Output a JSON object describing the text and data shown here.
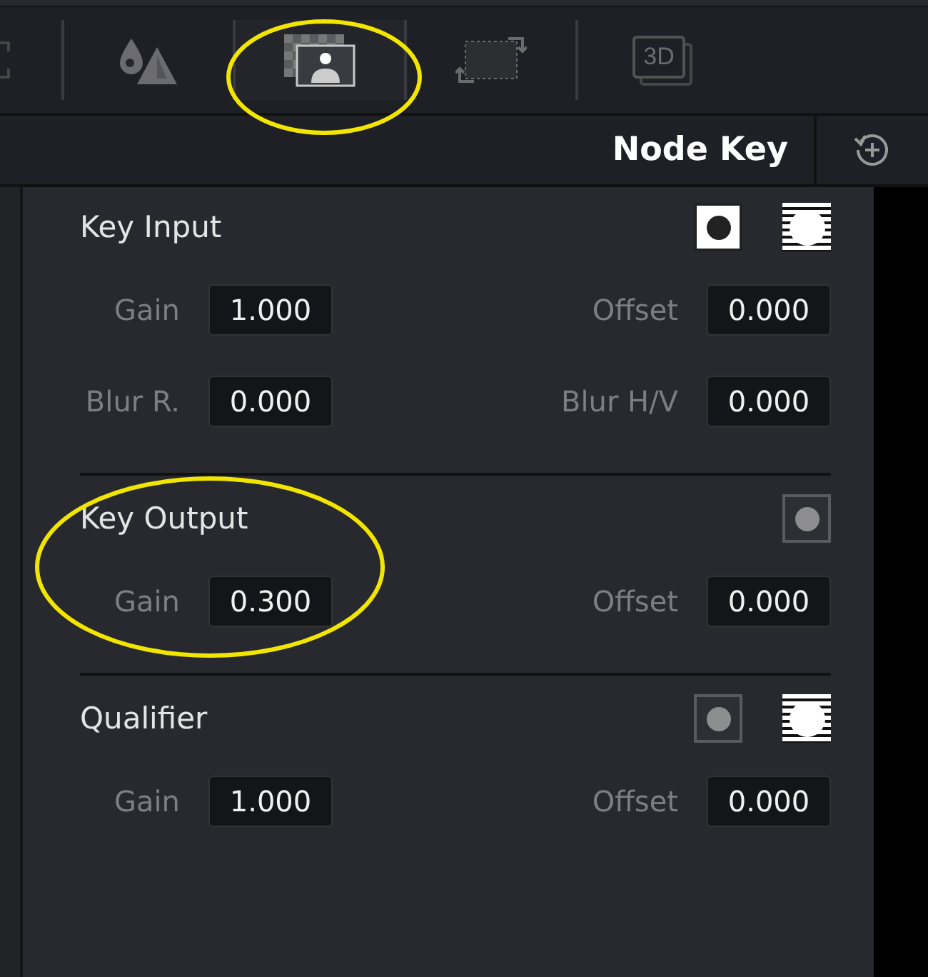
{
  "toolbar": {
    "tools": [
      {
        "kind": "partial",
        "selected": false
      },
      {
        "kind": "qualifier",
        "selected": false
      },
      {
        "kind": "key",
        "selected": true
      },
      {
        "kind": "sizing",
        "selected": false
      },
      {
        "kind": "stereo",
        "label": "3D",
        "selected": false
      }
    ]
  },
  "header": {
    "title": "Node Key"
  },
  "sections": [
    {
      "title": "Key Input",
      "toggles": [
        {
          "kind": "dot",
          "on": true
        },
        {
          "kind": "matte"
        }
      ],
      "rows": [
        [
          {
            "label": "Gain",
            "value": "1.000"
          },
          {
            "label": "Offset",
            "value": "0.000"
          }
        ],
        [
          {
            "label": "Blur R.",
            "value": "0.000"
          },
          {
            "label": "Blur H/V",
            "value": "0.000"
          }
        ]
      ]
    },
    {
      "title": "Key Output",
      "toggles": [
        {
          "kind": "dot",
          "on": false
        }
      ],
      "rows": [
        [
          {
            "label": "Gain",
            "value": "0.300"
          },
          {
            "label": "Offset",
            "value": "0.000"
          }
        ]
      ]
    },
    {
      "title": "Qualifier",
      "toggles": [
        {
          "kind": "dot",
          "on": false
        },
        {
          "kind": "matte"
        }
      ],
      "rows": [
        [
          {
            "label": "Gain",
            "value": "1.000"
          },
          {
            "label": "Offset",
            "value": "0.000"
          }
        ]
      ]
    }
  ]
}
